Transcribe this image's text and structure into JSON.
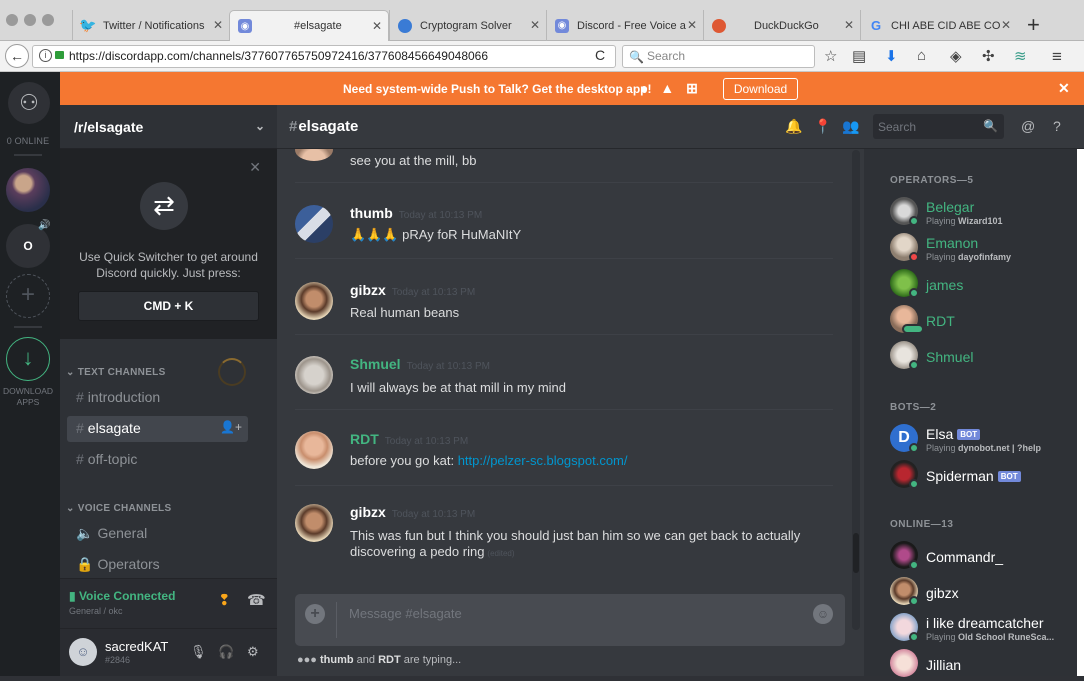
{
  "browser": {
    "tabs": [
      {
        "title": "Twitter / Notifications",
        "icon": "twitter-icon",
        "color": "#1da1f2",
        "active": false
      },
      {
        "title": "#elsagate",
        "icon": "discord-icon",
        "color": "#7289da",
        "active": true
      },
      {
        "title": "Cryptogram Solver",
        "icon": "globe-icon",
        "color": "#3a7bd5",
        "active": false
      },
      {
        "title": "Discord - Free Voice a",
        "icon": "discord-icon",
        "color": "#7289da",
        "active": false
      },
      {
        "title": "DuckDuckGo",
        "icon": "duckduckgo-icon",
        "color": "#de5833",
        "active": false
      },
      {
        "title": "CHI ABE CID ABE COD",
        "icon": "google-icon",
        "color": "#4285f4",
        "active": false
      }
    ],
    "url": "https://discordapp.com/channels/377607765750972416/377608456649048066",
    "search_placeholder": "Search"
  },
  "banner": {
    "text": "Need system-wide Push to Talk? Get the desktop app!",
    "download_label": "Download"
  },
  "guilds": {
    "online_label": "0 ONLINE",
    "server_initial": "O",
    "download_label": "DOWNLOAD APPS"
  },
  "server": {
    "name": "/r/elsagate",
    "quick_switcher": {
      "text": "Use Quick Switcher to get around Discord quickly. Just press:",
      "shortcut": "CMD + K"
    },
    "text_category": "TEXT CHANNELS",
    "text_channels": [
      "introduction",
      "elsagate",
      "off-topic"
    ],
    "voice_category": "VOICE CHANNELS",
    "voice_channels": [
      "General",
      "Operators"
    ],
    "voice_status": "Voice Connected",
    "voice_location": "General / okc",
    "user": {
      "name": "sacredKAT",
      "tag": "#2846"
    }
  },
  "chat": {
    "channel": "elsagate",
    "search_placeholder": "Search",
    "messages": [
      {
        "author": "",
        "time": "",
        "text": "see you at the mill, bb",
        "color": "#ffffff"
      },
      {
        "author": "thumb",
        "time": "Today at 10:13 PM",
        "text": "🙏🙏🙏 pRAy foR HuMaNItY",
        "color": "#ffffff"
      },
      {
        "author": "gibzx",
        "time": "Today at 10:13 PM",
        "text": "Real human beans",
        "color": "#ffffff"
      },
      {
        "author": "Shmuel",
        "time": "Today at 10:13 PM",
        "text": "I will always be at that mill in my mind",
        "color": "#43b581"
      },
      {
        "author": "RDT",
        "time": "Today at 10:13 PM",
        "text": "before you go kat: ",
        "link": "http://pelzer-sc.blogspot.com/",
        "color": "#43b581"
      },
      {
        "author": "gibzx",
        "time": "Today at 10:13 PM",
        "text": "This was fun but I think you should just ban him so we can get back to actually discovering a pedo ring",
        "edited": "(edited)",
        "color": "#ffffff"
      }
    ],
    "composer_placeholder": "Message #elsagate",
    "typing": {
      "user1": "thumb",
      "and": "and",
      "user2": "RDT",
      "suffix": "are typing..."
    }
  },
  "members": {
    "operators_label": "OPERATORS—5",
    "operators": [
      {
        "name": "Belegar",
        "playing_prefix": "Playing",
        "game": "Wizard101",
        "status": "online"
      },
      {
        "name": "Emanon",
        "playing_prefix": "Playing",
        "game": "dayofinfamy",
        "status": "dnd"
      },
      {
        "name": "james",
        "playing_prefix": "",
        "game": "",
        "status": "online"
      },
      {
        "name": "RDT",
        "playing_prefix": "",
        "game": "",
        "status": "online"
      },
      {
        "name": "Shmuel",
        "playing_prefix": "",
        "game": "",
        "status": "online"
      }
    ],
    "bots_label": "BOTS—2",
    "bots": [
      {
        "name": "Elsa",
        "badge": "BOT",
        "playing_prefix": "Playing",
        "game": "dynobot.net | ?help",
        "status": "online"
      },
      {
        "name": "Spiderman",
        "badge": "BOT",
        "playing_prefix": "",
        "game": "",
        "status": "online"
      }
    ],
    "online_label": "ONLINE—13",
    "online": [
      {
        "name": "Commandr_",
        "playing_prefix": "",
        "game": "",
        "status": "online"
      },
      {
        "name": "gibzx",
        "playing_prefix": "",
        "game": "",
        "status": "online"
      },
      {
        "name": "i like dreamcatcher",
        "playing_prefix": "Playing",
        "game": "Old School RuneSca...",
        "status": "online"
      },
      {
        "name": "Jillian",
        "playing_prefix": "",
        "game": "",
        "status": "online"
      }
    ]
  },
  "colors": {
    "banner": "#f57731",
    "online": "#43b581",
    "link": "#0096cf",
    "bot_badge": "#7289da"
  }
}
